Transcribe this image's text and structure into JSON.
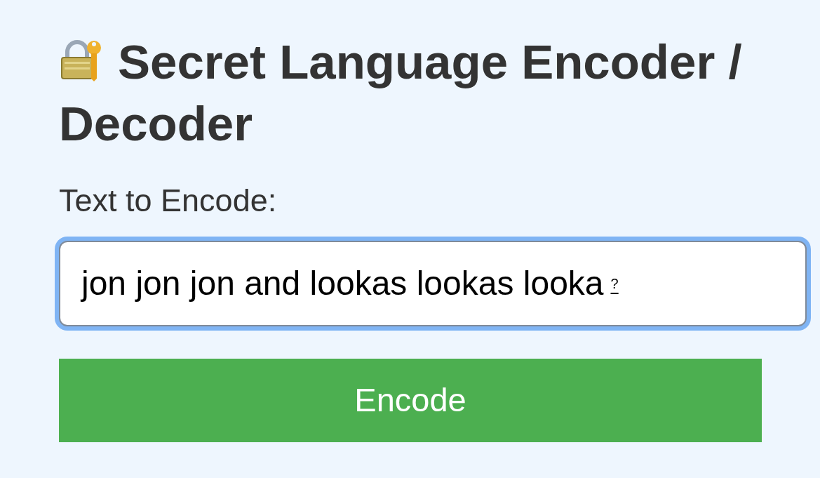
{
  "title": "Secret Language Encoder / Decoder",
  "field": {
    "label": "Text to Encode:",
    "value": "jon jon jon and lookas lookas looka",
    "focused": true,
    "suggestion_mark": "?"
  },
  "button": {
    "label": "Encode"
  }
}
